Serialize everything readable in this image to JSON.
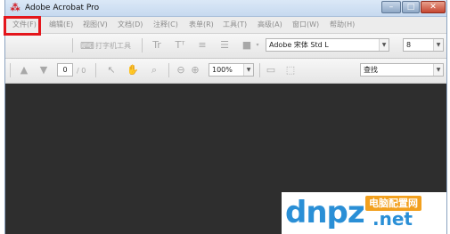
{
  "window": {
    "title": "Adobe Acrobat Pro",
    "app_icon": "acrobat-logo-icon",
    "controls": {
      "minimize": "–",
      "maximize": "□",
      "close": "✕"
    }
  },
  "menubar": {
    "items": [
      {
        "label": "文件(F)"
      },
      {
        "label": "编辑(E)"
      },
      {
        "label": "视图(V)"
      },
      {
        "label": "文档(D)"
      },
      {
        "label": "注释(C)"
      },
      {
        "label": "表单(R)"
      },
      {
        "label": "工具(T)"
      },
      {
        "label": "高级(A)"
      },
      {
        "label": "窗口(W)"
      },
      {
        "label": "帮助(H)"
      }
    ],
    "highlight_color": "#e4161c"
  },
  "toolbar1": {
    "typewriter_label": "打字机工具",
    "font_name": "Adobe 宋体 Std L",
    "font_size": "8"
  },
  "toolbar2": {
    "page_current": "0",
    "page_total": "/ 0",
    "zoom": "100%",
    "search_label": "查找"
  },
  "watermark": {
    "logo": "dnpz",
    "tagline": "电脑配置网",
    "domain": ".net"
  },
  "colors": {
    "doc_background": "#2e2e2e",
    "titlebar": "#c6d9ef",
    "watermark_blue": "#2a8fd6",
    "watermark_orange": "#f2a01e"
  }
}
